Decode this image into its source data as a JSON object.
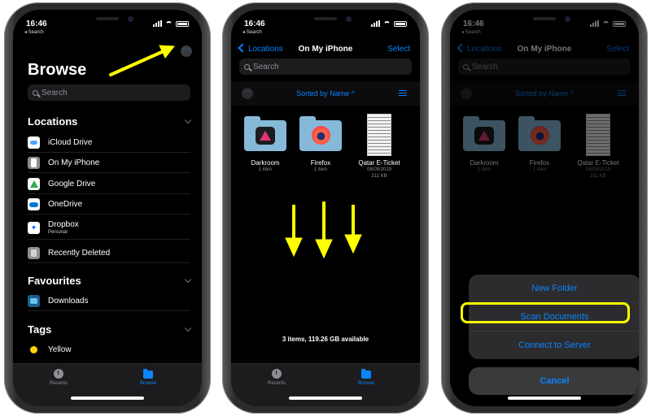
{
  "status": {
    "time": "16:46",
    "back_label": "◂ Search"
  },
  "browse": {
    "more_icon": "ellipsis-icon",
    "title": "Browse",
    "search_placeholder": "Search",
    "locations_header": "Locations",
    "locations": [
      {
        "label": "iCloud Drive",
        "icon": "icloud-icon"
      },
      {
        "label": "On My iPhone",
        "icon": "iphone-icon"
      },
      {
        "label": "Google Drive",
        "icon": "google-drive-icon"
      },
      {
        "label": "OneDrive",
        "icon": "onedrive-icon"
      },
      {
        "label": "Dropbox",
        "sub": "Personal",
        "icon": "dropbox-icon"
      },
      {
        "label": "Recently Deleted",
        "icon": "trash-icon"
      }
    ],
    "favourites_header": "Favourites",
    "favourites": [
      {
        "label": "Downloads",
        "icon": "downloads-folder-icon"
      }
    ],
    "tags_header": "Tags",
    "tags": [
      {
        "label": "Yellow",
        "color": "#ffd60a"
      }
    ]
  },
  "tabs": {
    "recents": "Recents",
    "browse": "Browse"
  },
  "files": {
    "back_label": "Locations",
    "title": "On My iPhone",
    "select_label": "Select",
    "search_placeholder": "Search",
    "sort_label": "Sorted by Name",
    "sort_arrow": "^",
    "items": [
      {
        "name": "Darkroom",
        "meta1": "1 item",
        "meta2": ""
      },
      {
        "name": "Firefox",
        "meta1": "1 item",
        "meta2": ""
      },
      {
        "name": "Qatar E-Ticket",
        "meta1": "08/09/2019",
        "meta2": "211 KB"
      }
    ],
    "footer": "3 items, 119.26 GB available"
  },
  "sheet": {
    "new_folder": "New Folder",
    "scan_documents": "Scan Documents",
    "connect_to_server": "Connect to Server",
    "cancel": "Cancel"
  },
  "colors": {
    "accent": "#0a84ff",
    "annotation": "#ffff00",
    "background": "#000000"
  }
}
